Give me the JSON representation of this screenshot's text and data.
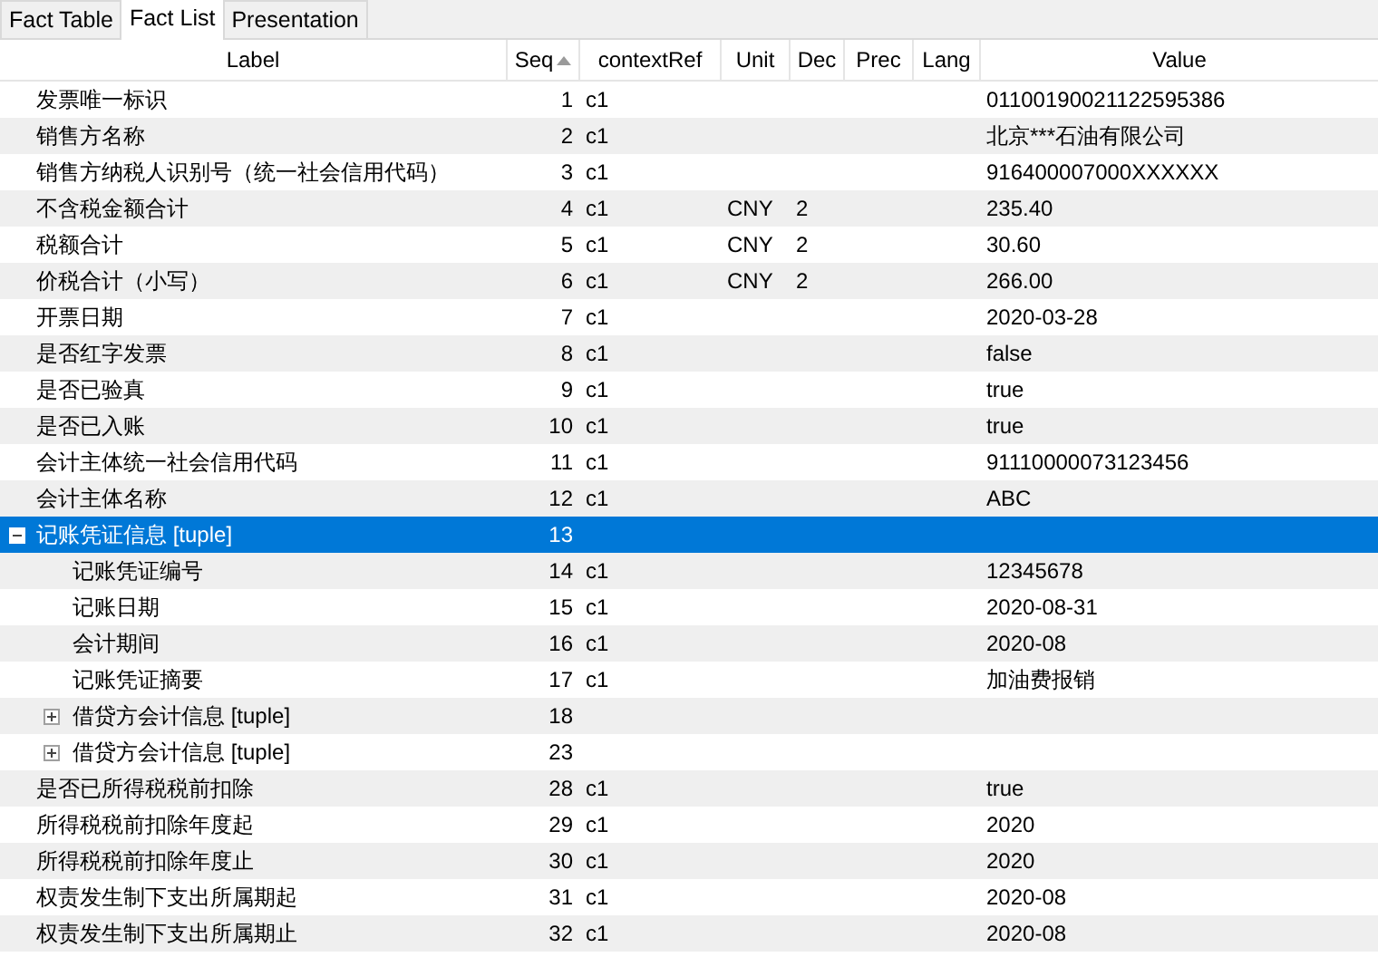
{
  "tabs": [
    {
      "label": "Fact Table",
      "selected": false
    },
    {
      "label": "Fact List",
      "selected": true
    },
    {
      "label": "Presentation",
      "selected": false
    }
  ],
  "columns": [
    {
      "label": "Label",
      "sorted": false
    },
    {
      "label": "Seq",
      "sorted": true
    },
    {
      "label": "contextRef",
      "sorted": false
    },
    {
      "label": "Unit",
      "sorted": false
    },
    {
      "label": "Dec",
      "sorted": false
    },
    {
      "label": "Prec",
      "sorted": false
    },
    {
      "label": "Lang",
      "sorted": false
    },
    {
      "label": "Value",
      "sorted": false
    }
  ],
  "rows": [
    {
      "label": "发票唯一标识",
      "seq": "1",
      "context": "c1",
      "value": "01100190021122595386",
      "selected": false
    },
    {
      "label": "销售方名称",
      "seq": "2",
      "context": "c1",
      "value": "北京***石油有限公司",
      "selected": false
    },
    {
      "label": "销售方纳税人识别号（统一社会信用代码）",
      "seq": "3",
      "context": "c1",
      "value": "916400007000XXXXXX",
      "selected": false
    },
    {
      "label": "不含税金额合计",
      "seq": "4",
      "context": "c1",
      "unit": "CNY",
      "dec": "2",
      "value": "235.40",
      "selected": false
    },
    {
      "label": "税额合计",
      "seq": "5",
      "context": "c1",
      "unit": "CNY",
      "dec": "2",
      "value": "30.60",
      "selected": false
    },
    {
      "label": "价税合计（小写）",
      "seq": "6",
      "context": "c1",
      "unit": "CNY",
      "dec": "2",
      "value": "266.00",
      "selected": false
    },
    {
      "label": "开票日期",
      "seq": "7",
      "context": "c1",
      "value": "2020-03-28",
      "selected": false
    },
    {
      "label": "是否红字发票",
      "seq": "8",
      "context": "c1",
      "value": "false",
      "selected": false
    },
    {
      "label": "是否已验真",
      "seq": "9",
      "context": "c1",
      "value": "true",
      "selected": false
    },
    {
      "label": "是否已入账",
      "seq": "10",
      "context": "c1",
      "value": "true",
      "selected": false
    },
    {
      "label": "会计主体统一社会信用代码",
      "seq": "11",
      "context": "c1",
      "value": "91110000073123456",
      "selected": false
    },
    {
      "label": "会计主体名称",
      "seq": "12",
      "context": "c1",
      "value": "ABC",
      "selected": false
    },
    {
      "label": "记账凭证信息 [tuple]",
      "seq": "13",
      "selected": true,
      "expanded": true,
      "children": [
        {
          "label": "记账凭证编号",
          "seq": "14",
          "context": "c1",
          "value": "12345678",
          "selected": false
        },
        {
          "label": "记账日期",
          "seq": "15",
          "context": "c1",
          "value": "2020-08-31",
          "selected": false
        },
        {
          "label": "会计期间",
          "seq": "16",
          "context": "c1",
          "value": "2020-08",
          "selected": false
        },
        {
          "label": "记账凭证摘要",
          "seq": "17",
          "context": "c1",
          "value": "加油费报销",
          "selected": false
        },
        {
          "label": "借贷方会计信息 [tuple]",
          "seq": "18",
          "selected": false,
          "expanded": false
        },
        {
          "label": "借贷方会计信息 [tuple]",
          "seq": "23",
          "selected": false,
          "expanded": false
        }
      ]
    },
    {
      "label": "是否已所得税税前扣除",
      "seq": "28",
      "context": "c1",
      "value": "true",
      "selected": false
    },
    {
      "label": "所得税税前扣除年度起",
      "seq": "29",
      "context": "c1",
      "value": "2020",
      "selected": false
    },
    {
      "label": "所得税税前扣除年度止",
      "seq": "30",
      "context": "c1",
      "value": "2020",
      "selected": false
    },
    {
      "label": "权责发生制下支出所属期起",
      "seq": "31",
      "context": "c1",
      "value": "2020-08",
      "selected": false
    },
    {
      "label": "权责发生制下支出所属期止",
      "seq": "32",
      "context": "c1",
      "value": "2020-08",
      "selected": false
    }
  ]
}
